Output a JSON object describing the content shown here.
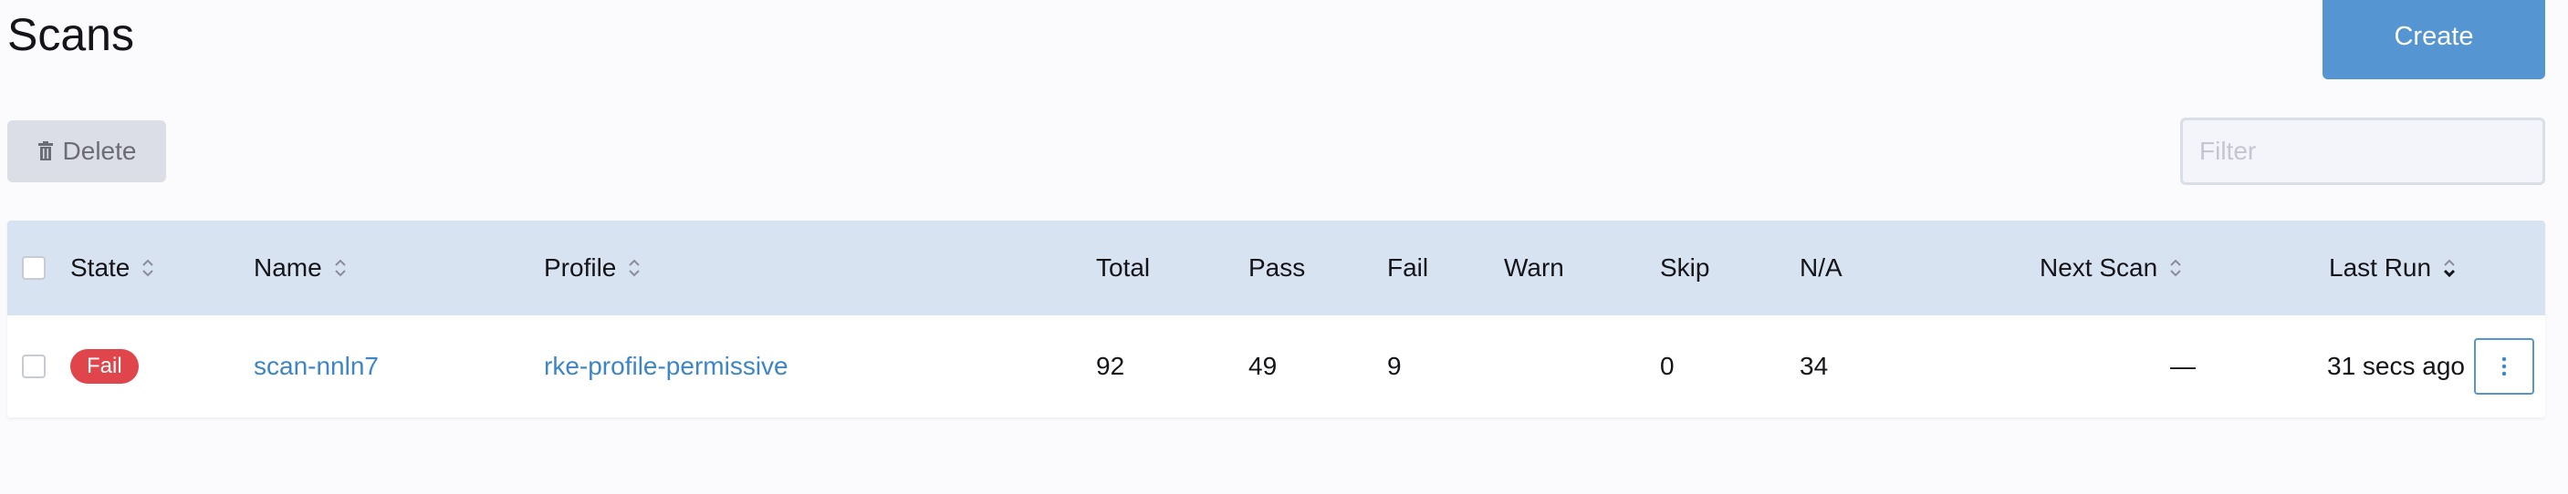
{
  "header": {
    "title": "Scans",
    "create_label": "Create"
  },
  "toolbar": {
    "delete_label": "Delete",
    "filter_placeholder": "Filter"
  },
  "table": {
    "columns": [
      {
        "label": "State",
        "sortable": true
      },
      {
        "label": "Name",
        "sortable": true
      },
      {
        "label": "Profile",
        "sortable": true
      },
      {
        "label": "Total",
        "sortable": false
      },
      {
        "label": "Pass",
        "sortable": false
      },
      {
        "label": "Fail",
        "sortable": false
      },
      {
        "label": "Warn",
        "sortable": false
      },
      {
        "label": "Skip",
        "sortable": false
      },
      {
        "label": "N/A",
        "sortable": false
      },
      {
        "label": "Next Scan",
        "sortable": true
      },
      {
        "label": "Last Run",
        "sortable": true,
        "sorted": "desc"
      }
    ],
    "rows": [
      {
        "state": "Fail",
        "name": "scan-nnln7",
        "profile": "rke-profile-permissive",
        "total": "92",
        "pass": "49",
        "fail": "9",
        "warn": "",
        "skip": "0",
        "na": "34",
        "next_scan": "—",
        "last_run": "31 secs ago"
      }
    ]
  },
  "colors": {
    "accent": "#5595d1",
    "link": "#3d85c6",
    "fail_badge": "#e0454b",
    "header_bg": "#d8e3f2"
  },
  "icons": {
    "delete": "trash-icon",
    "sort": "sort-arrows-icon",
    "actions": "vertical-dots-icon"
  }
}
